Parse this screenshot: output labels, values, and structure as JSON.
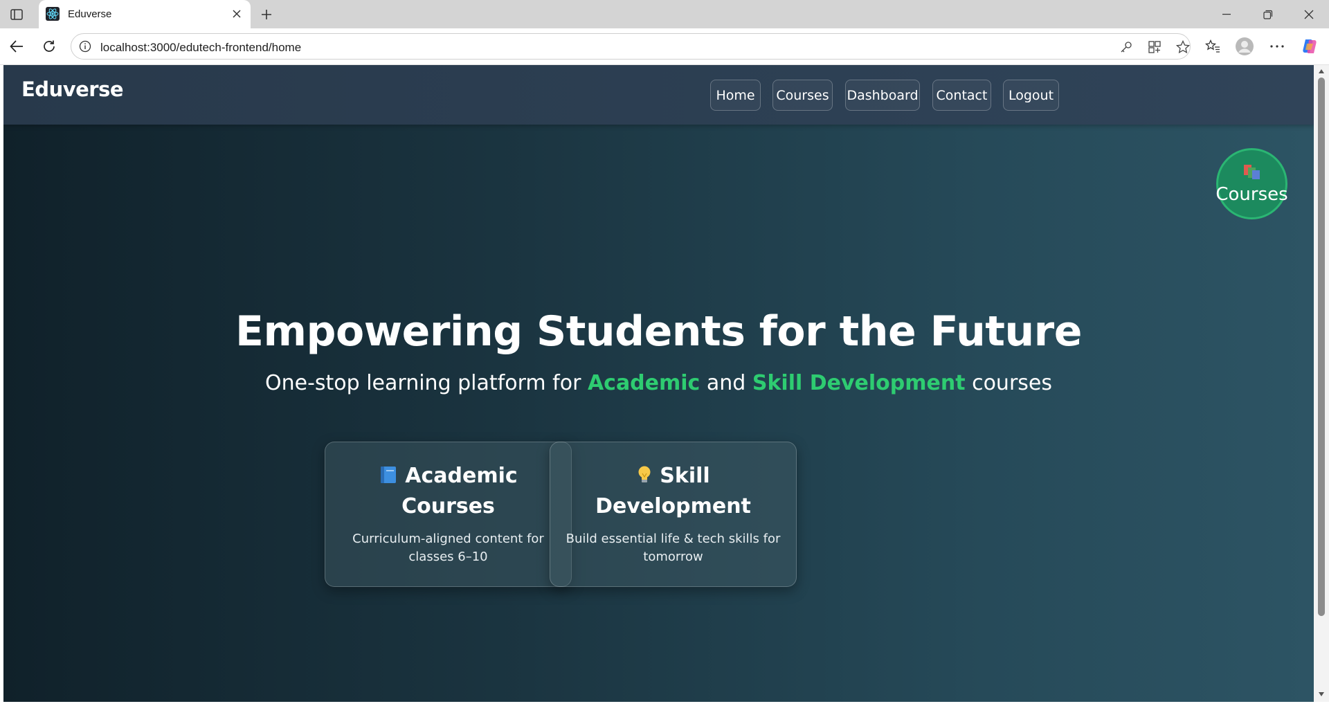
{
  "browser": {
    "tab_title": "Eduverse",
    "url": "localhost:3000/edutech-frontend/home",
    "icons": [
      "sidebar-toggle-icon",
      "react-favicon-icon",
      "close-icon",
      "plus-icon",
      "minimize-icon",
      "restore-icon",
      "window-close-icon",
      "back-arrow-icon",
      "reload-icon",
      "info-icon",
      "key-icon",
      "apps-icon",
      "star-icon",
      "favorites-icon",
      "profile-icon",
      "more-icon",
      "copilot-icon"
    ]
  },
  "navbar": {
    "brand": "Eduverse",
    "links": [
      "Home",
      "Courses",
      "Dashboard",
      "Contact",
      "Logout"
    ]
  },
  "floating_badge": {
    "label": "Courses",
    "icon": "books-icon"
  },
  "hero": {
    "title": "Empowering Students for the Future",
    "subtitle_parts": [
      "One-stop learning platform for ",
      "Academic",
      " and ",
      "Skill Development",
      " courses"
    ]
  },
  "cards": [
    {
      "icon": "blue-book-icon",
      "title": "Academic Courses",
      "description": "Curriculum-aligned content for classes 6–10"
    },
    {
      "icon": "lightbulb-icon",
      "title": "Skill Development",
      "description": "Build essential life & tech skills for tomorrow"
    }
  ],
  "colors": {
    "accent_green": "#2ecc71",
    "navbar_bg": "#304459",
    "hero_bg_left": "#10212a",
    "hero_bg_right": "#2d5464"
  }
}
